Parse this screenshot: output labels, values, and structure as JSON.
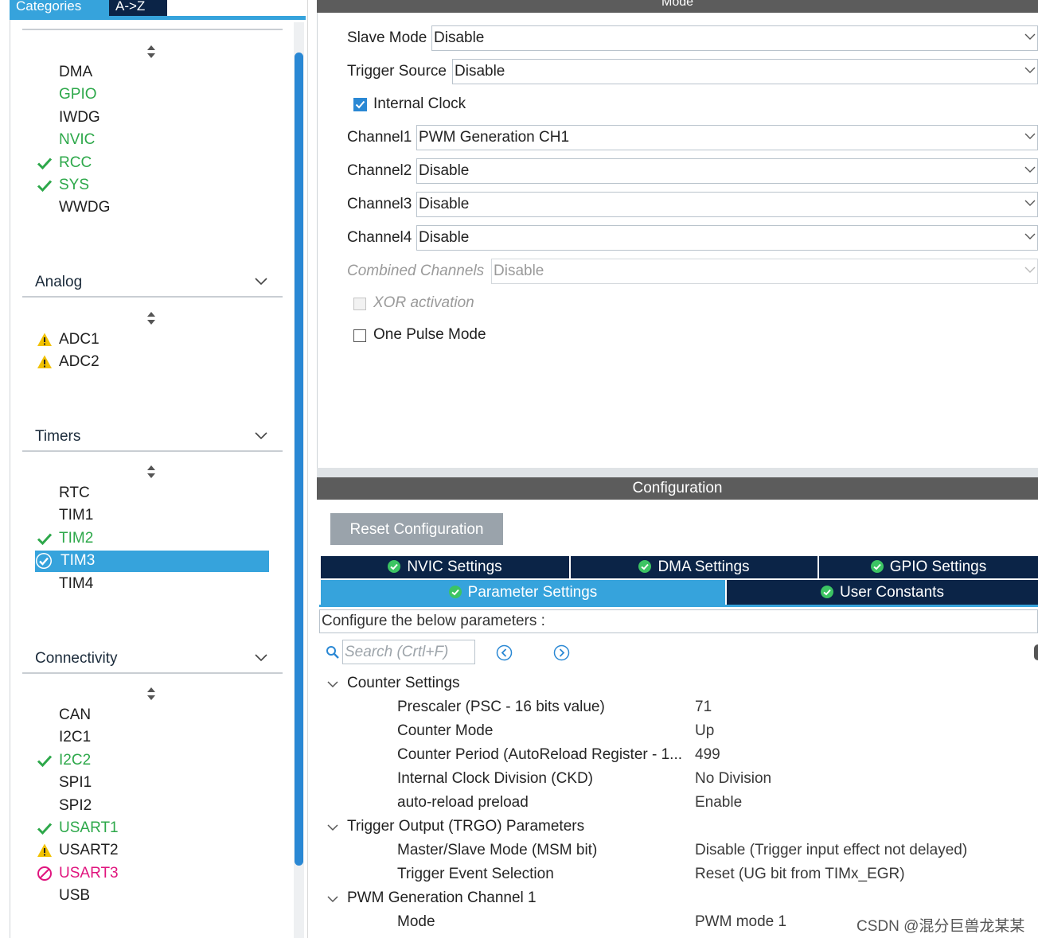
{
  "left_panel": {
    "tabs": {
      "categories": "Categories",
      "az": "A->Z"
    },
    "system_core": {
      "items": [
        {
          "label": "DMA",
          "status": "none"
        },
        {
          "label": "GPIO",
          "status": "green"
        },
        {
          "label": "IWDG",
          "status": "none"
        },
        {
          "label": "NVIC",
          "status": "green"
        },
        {
          "label": "RCC",
          "status": "check"
        },
        {
          "label": "SYS",
          "status": "check"
        },
        {
          "label": "WWDG",
          "status": "none"
        }
      ]
    },
    "analog": {
      "title": "Analog",
      "items": [
        {
          "label": "ADC1",
          "status": "warning"
        },
        {
          "label": "ADC2",
          "status": "warning"
        }
      ]
    },
    "timers": {
      "title": "Timers",
      "items": [
        {
          "label": "RTC",
          "status": "none"
        },
        {
          "label": "TIM1",
          "status": "none"
        },
        {
          "label": "TIM2",
          "status": "check"
        },
        {
          "label": "TIM3",
          "status": "selected"
        },
        {
          "label": "TIM4",
          "status": "none"
        }
      ]
    },
    "connectivity": {
      "title": "Connectivity",
      "items": [
        {
          "label": "CAN",
          "status": "none"
        },
        {
          "label": "I2C1",
          "status": "none"
        },
        {
          "label": "I2C2",
          "status": "check"
        },
        {
          "label": "SPI1",
          "status": "none"
        },
        {
          "label": "SPI2",
          "status": "none"
        },
        {
          "label": "USART1",
          "status": "check"
        },
        {
          "label": "USART2",
          "status": "warning"
        },
        {
          "label": "USART3",
          "status": "blocked"
        },
        {
          "label": "USB",
          "status": "none"
        }
      ]
    }
  },
  "mode": {
    "title": "Mode",
    "slave_mode": {
      "label": "Slave Mode",
      "value": "Disable"
    },
    "trigger_source": {
      "label": "Trigger Source",
      "value": "Disable"
    },
    "internal_clock": {
      "label": "Internal Clock",
      "checked": true
    },
    "channel1": {
      "label": "Channel1",
      "value": "PWM Generation CH1"
    },
    "channel2": {
      "label": "Channel2",
      "value": "Disable"
    },
    "channel3": {
      "label": "Channel3",
      "value": "Disable"
    },
    "channel4": {
      "label": "Channel4",
      "value": "Disable"
    },
    "combined_channels": {
      "label": "Combined Channels",
      "value": "Disable"
    },
    "xor_activation": {
      "label": "XOR activation",
      "checked": false
    },
    "one_pulse_mode": {
      "label": "One Pulse Mode",
      "checked": false
    }
  },
  "configuration": {
    "title": "Configuration",
    "reset_label": "Reset Configuration",
    "tabs": {
      "nvic": "NVIC Settings",
      "dma": "DMA Settings",
      "gpio": "GPIO Settings",
      "parameter": "Parameter Settings",
      "user_constants": "User Constants"
    },
    "configure_text": "Configure the below parameters :",
    "search_placeholder": "Search (Crtl+F)",
    "groups": [
      {
        "name": "Counter Settings",
        "params": [
          {
            "name": "Prescaler (PSC - 16 bits value)",
            "value": "71"
          },
          {
            "name": "Counter Mode",
            "value": "Up"
          },
          {
            "name": "Counter Period (AutoReload Register - 1...",
            "value": "499"
          },
          {
            "name": "Internal Clock Division (CKD)",
            "value": "No Division"
          },
          {
            "name": "auto-reload preload",
            "value": "Enable"
          }
        ]
      },
      {
        "name": "Trigger Output (TRGO) Parameters",
        "params": [
          {
            "name": "Master/Slave Mode (MSM bit)",
            "value": "Disable (Trigger input effect not delayed)"
          },
          {
            "name": "Trigger Event Selection",
            "value": "Reset (UG bit from TIMx_EGR)"
          }
        ]
      },
      {
        "name": "PWM Generation Channel 1",
        "params": [
          {
            "name": "Mode",
            "value": "PWM mode 1"
          }
        ]
      }
    ]
  },
  "watermark": "CSDN @混分巨兽龙某某",
  "colors": {
    "accent_blue": "#36a3dc",
    "dark_navy": "#0b2447",
    "green": "#2da84a",
    "warning": "#f2c200",
    "blocked": "#e0157e"
  }
}
